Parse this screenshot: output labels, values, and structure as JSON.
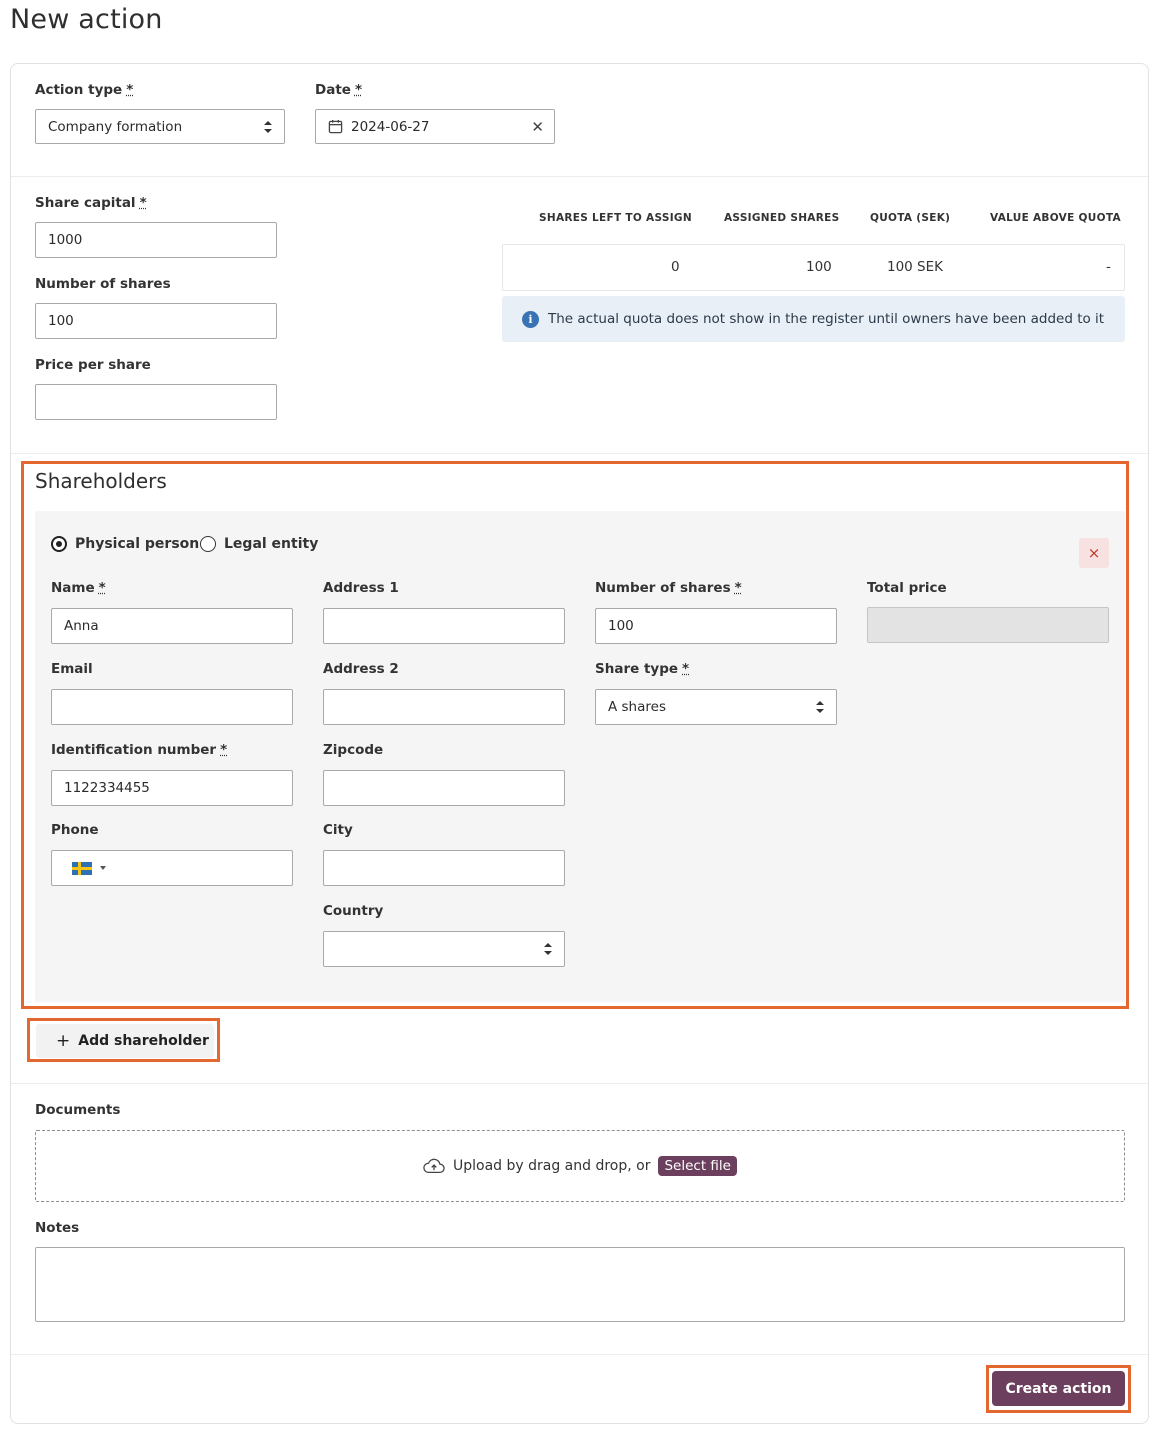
{
  "page": {
    "title": "New action"
  },
  "action": {
    "type_label": "Action type",
    "type_value": "Company formation",
    "date_label": "Date",
    "date_value": "2024-06-27",
    "required_mark": "*"
  },
  "capital": {
    "share_capital_label": "Share capital",
    "share_capital_value": "1000",
    "num_shares_label": "Number of shares",
    "num_shares_value": "100",
    "price_per_share_label": "Price per share",
    "price_per_share_value": ""
  },
  "quota_table": {
    "headers": [
      "SHARES LEFT TO ASSIGN",
      "ASSIGNED SHARES",
      "QUOTA (SEK)",
      "VALUE ABOVE QUOTA"
    ],
    "row": [
      "0",
      "100",
      "100 SEK",
      "-"
    ],
    "info_text": "The actual quota does not show in the register until owners have been added to it"
  },
  "shareholders": {
    "title": "Shareholders",
    "type_options": [
      "Physical person",
      "Legal entity"
    ],
    "selected_type": "Physical person",
    "remove_label": "×",
    "fields": {
      "name_label": "Name",
      "name_value": "Anna",
      "email_label": "Email",
      "email_value": "",
      "id_label": "Identification number",
      "id_value": "1122334455",
      "phone_label": "Phone",
      "address1_label": "Address 1",
      "address2_label": "Address 2",
      "zipcode_label": "Zipcode",
      "city_label": "City",
      "country_label": "Country",
      "country_value": "",
      "num_shares_label": "Number of shares",
      "num_shares_value": "100",
      "share_type_label": "Share type",
      "share_type_value": "A shares",
      "total_price_label": "Total price"
    },
    "add_label": "Add shareholder"
  },
  "documents": {
    "label": "Documents",
    "upload_text": "Upload by drag and drop, or",
    "select_file": "Select file"
  },
  "notes": {
    "label": "Notes",
    "value": ""
  },
  "footer": {
    "create_label": "Create action"
  },
  "colors": {
    "accent": "#6b3f5d",
    "highlight": "#e3672e",
    "info_bg": "#e8eff6",
    "info_icon": "#3a73b4"
  }
}
